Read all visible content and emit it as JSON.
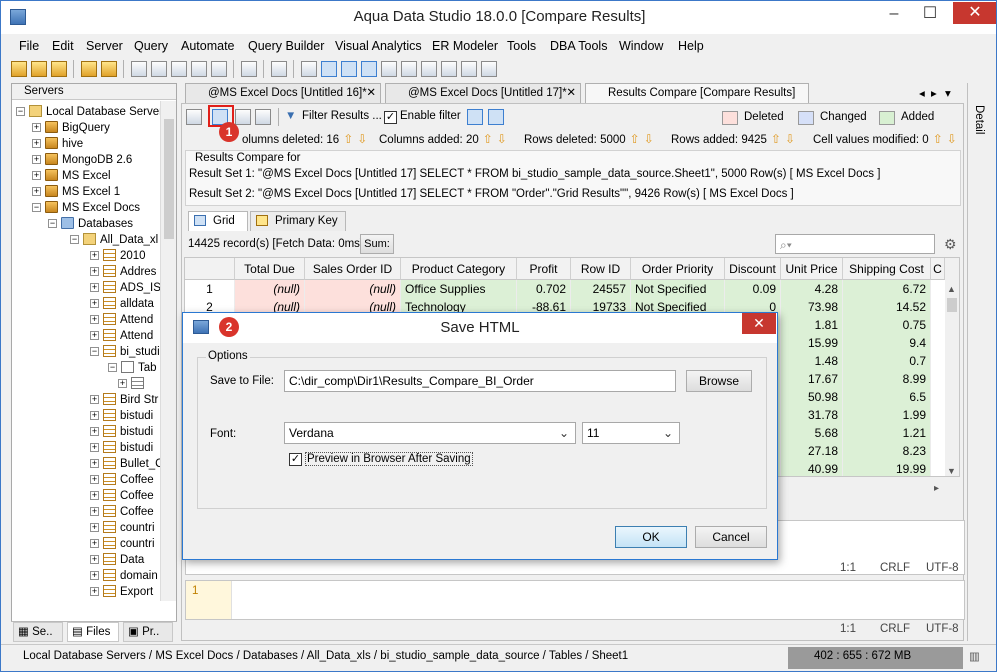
{
  "window": {
    "title": "Aqua Data Studio 18.0.0 [Compare Results]",
    "minimize": "–",
    "maximize": "☐",
    "close": "✕"
  },
  "menu": [
    "File",
    "Edit",
    "Server",
    "Query",
    "Automate",
    "Query Builder",
    "Visual Analytics",
    "ER Modeler",
    "Tools",
    "DBA Tools",
    "Window",
    "Help"
  ],
  "servers_panel": {
    "header": "Servers",
    "tree": [
      {
        "label": "Local Database Servers",
        "icon": "folder"
      },
      {
        "label": "BigQuery",
        "icon": "server"
      },
      {
        "label": "hive",
        "icon": "server"
      },
      {
        "label": "MongoDB 2.6",
        "icon": "server"
      },
      {
        "label": "MS Excel",
        "icon": "server"
      },
      {
        "label": "MS Excel 1",
        "icon": "server"
      },
      {
        "label": "MS Excel Docs",
        "icon": "server"
      },
      {
        "label": "Databases",
        "icon": "databases"
      },
      {
        "label": "All_Data_xl",
        "icon": "database"
      },
      {
        "label": "2010",
        "icon": "table"
      },
      {
        "label": "Addres",
        "icon": "table"
      },
      {
        "label": "ADS_IS",
        "icon": "table"
      },
      {
        "label": "alldata",
        "icon": "table"
      },
      {
        "label": "Attend",
        "icon": "table"
      },
      {
        "label": "Attend",
        "icon": "table"
      },
      {
        "label": "bi_studi",
        "icon": "table"
      },
      {
        "label": "Tab",
        "icon": "folder"
      },
      {
        "label": "",
        "icon": "table"
      },
      {
        "label": "Bird Str",
        "icon": "table"
      },
      {
        "label": "bistudi",
        "icon": "table"
      },
      {
        "label": "bistudi",
        "icon": "table"
      },
      {
        "label": "bistudi",
        "icon": "table"
      },
      {
        "label": "Bullet_C",
        "icon": "table"
      },
      {
        "label": "Coffee",
        "icon": "table"
      },
      {
        "label": "Coffee",
        "icon": "table"
      },
      {
        "label": "Coffee",
        "icon": "table"
      },
      {
        "label": "countri",
        "icon": "table"
      },
      {
        "label": "countri",
        "icon": "table"
      },
      {
        "label": "Data",
        "icon": "table"
      },
      {
        "label": "domain",
        "icon": "table"
      },
      {
        "label": "Export",
        "icon": "table"
      }
    ],
    "bottom_tabs": [
      "Se..",
      "Files",
      "Pr.."
    ]
  },
  "doc_tabs": [
    {
      "label": "@MS Excel Docs [Untitled 16]*",
      "close": "✕"
    },
    {
      "label": "@MS Excel Docs [Untitled 17]*",
      "close": "✕"
    },
    {
      "label": "Results Compare [Compare Results]",
      "close": ""
    }
  ],
  "compare_toolbar": {
    "filter_label": "Filter Results ...",
    "enable_filter_label": "Enable filter",
    "enable_filter_checked": true,
    "legend": [
      {
        "label": "Deleted",
        "color": "#fde0dc"
      },
      {
        "label": "Changed",
        "color": "#d6e0f8"
      },
      {
        "label": "Added",
        "color": "#d8f0d2"
      }
    ]
  },
  "stats": {
    "columns_deleted": "olumns deleted: 16",
    "columns_added": "Columns added: 20",
    "rows_deleted": "Rows deleted: 5000",
    "rows_added": "Rows added: 9425",
    "cells_modified": "Cell values modified: 0"
  },
  "compare_info": {
    "heading": "Results Compare for",
    "set1": "Result Set 1: \"@MS Excel Docs [Untitled 17] SELECT * FROM bi_studio_sample_data_source.Sheet1\", 5000 Row(s)  [ MS Excel Docs ]",
    "set2": "Result Set 2: \"@MS Excel Docs [Untitled 17] SELECT * FROM \"Order\".\"Grid Results\"\", 9426 Row(s)  [ MS Excel Docs ]"
  },
  "result_tabs": [
    "Grid",
    "Primary Key"
  ],
  "grid_status": {
    "records": "14425 record(s) [Fetch Data: 0ms]",
    "sum_button": "Sum:"
  },
  "grid": {
    "columns": [
      "",
      "Total Due",
      "Sales Order ID",
      "Product Category",
      "Profit",
      "Row ID",
      "Order Priority",
      "Discount",
      "Unit Price",
      "Shipping Cost",
      "C"
    ],
    "rows": [
      [
        "1",
        "(null)",
        "(null)",
        "Office Supplies",
        "0.702",
        "24557",
        "Not Specified",
        "0.09",
        "4.28",
        "6.72"
      ],
      [
        "2",
        "(null)",
        "(null)",
        "Technology",
        "-88.61",
        "19733",
        "Not Specified",
        "0",
        "73.98",
        "14.52"
      ],
      [
        "",
        "",
        "",
        "",
        "",
        "",
        "",
        "",
        "1.81",
        "0.75"
      ],
      [
        "",
        "",
        "",
        "",
        "",
        "",
        "",
        "",
        "15.99",
        "9.4"
      ],
      [
        "",
        "",
        "",
        "",
        "",
        "",
        "",
        "",
        "1.48",
        "0.7"
      ],
      [
        "",
        "",
        "",
        "",
        "",
        "",
        "",
        "",
        "17.67",
        "8.99"
      ],
      [
        "",
        "",
        "",
        "",
        "",
        "",
        "",
        "",
        "50.98",
        "6.5"
      ],
      [
        "",
        "",
        "",
        "",
        "",
        "",
        "",
        "",
        "31.78",
        "1.99"
      ],
      [
        "",
        "",
        "",
        "",
        "",
        "",
        "",
        "",
        "5.68",
        "1.21"
      ],
      [
        "",
        "",
        "",
        "",
        "",
        "",
        "",
        "",
        "27.18",
        "8.23"
      ],
      [
        "",
        "",
        "",
        "",
        "",
        "",
        "",
        "",
        "40.99",
        "19.99"
      ]
    ]
  },
  "editor1": {
    "pos": "1:1",
    "eol": "CRLF",
    "enc": "UTF-8"
  },
  "editor2": {
    "line": "1",
    "pos": "1:1",
    "eol": "CRLF",
    "enc": "UTF-8"
  },
  "dialog": {
    "title": "Save HTML",
    "close": "✕",
    "group": "Options",
    "save_label": "Save to File:",
    "save_value": "C:\\dir_comp\\Dir1\\Results_Compare_BI_Order",
    "browse": "Browse",
    "font_label": "Font:",
    "font_value": "Verdana",
    "size_value": "11",
    "preview_label": "Preview in Browser After Saving",
    "preview_checked": true,
    "ok": "OK",
    "cancel": "Cancel"
  },
  "badges": [
    "1",
    "2"
  ],
  "detail_tab": "Detail",
  "statusbar": {
    "path": "Local Database Servers / MS Excel Docs / Databases / All_Data_xls / bi_studio_sample_data_source / Tables / Sheet1",
    "memory": "402 : 655 : 672 MB"
  }
}
